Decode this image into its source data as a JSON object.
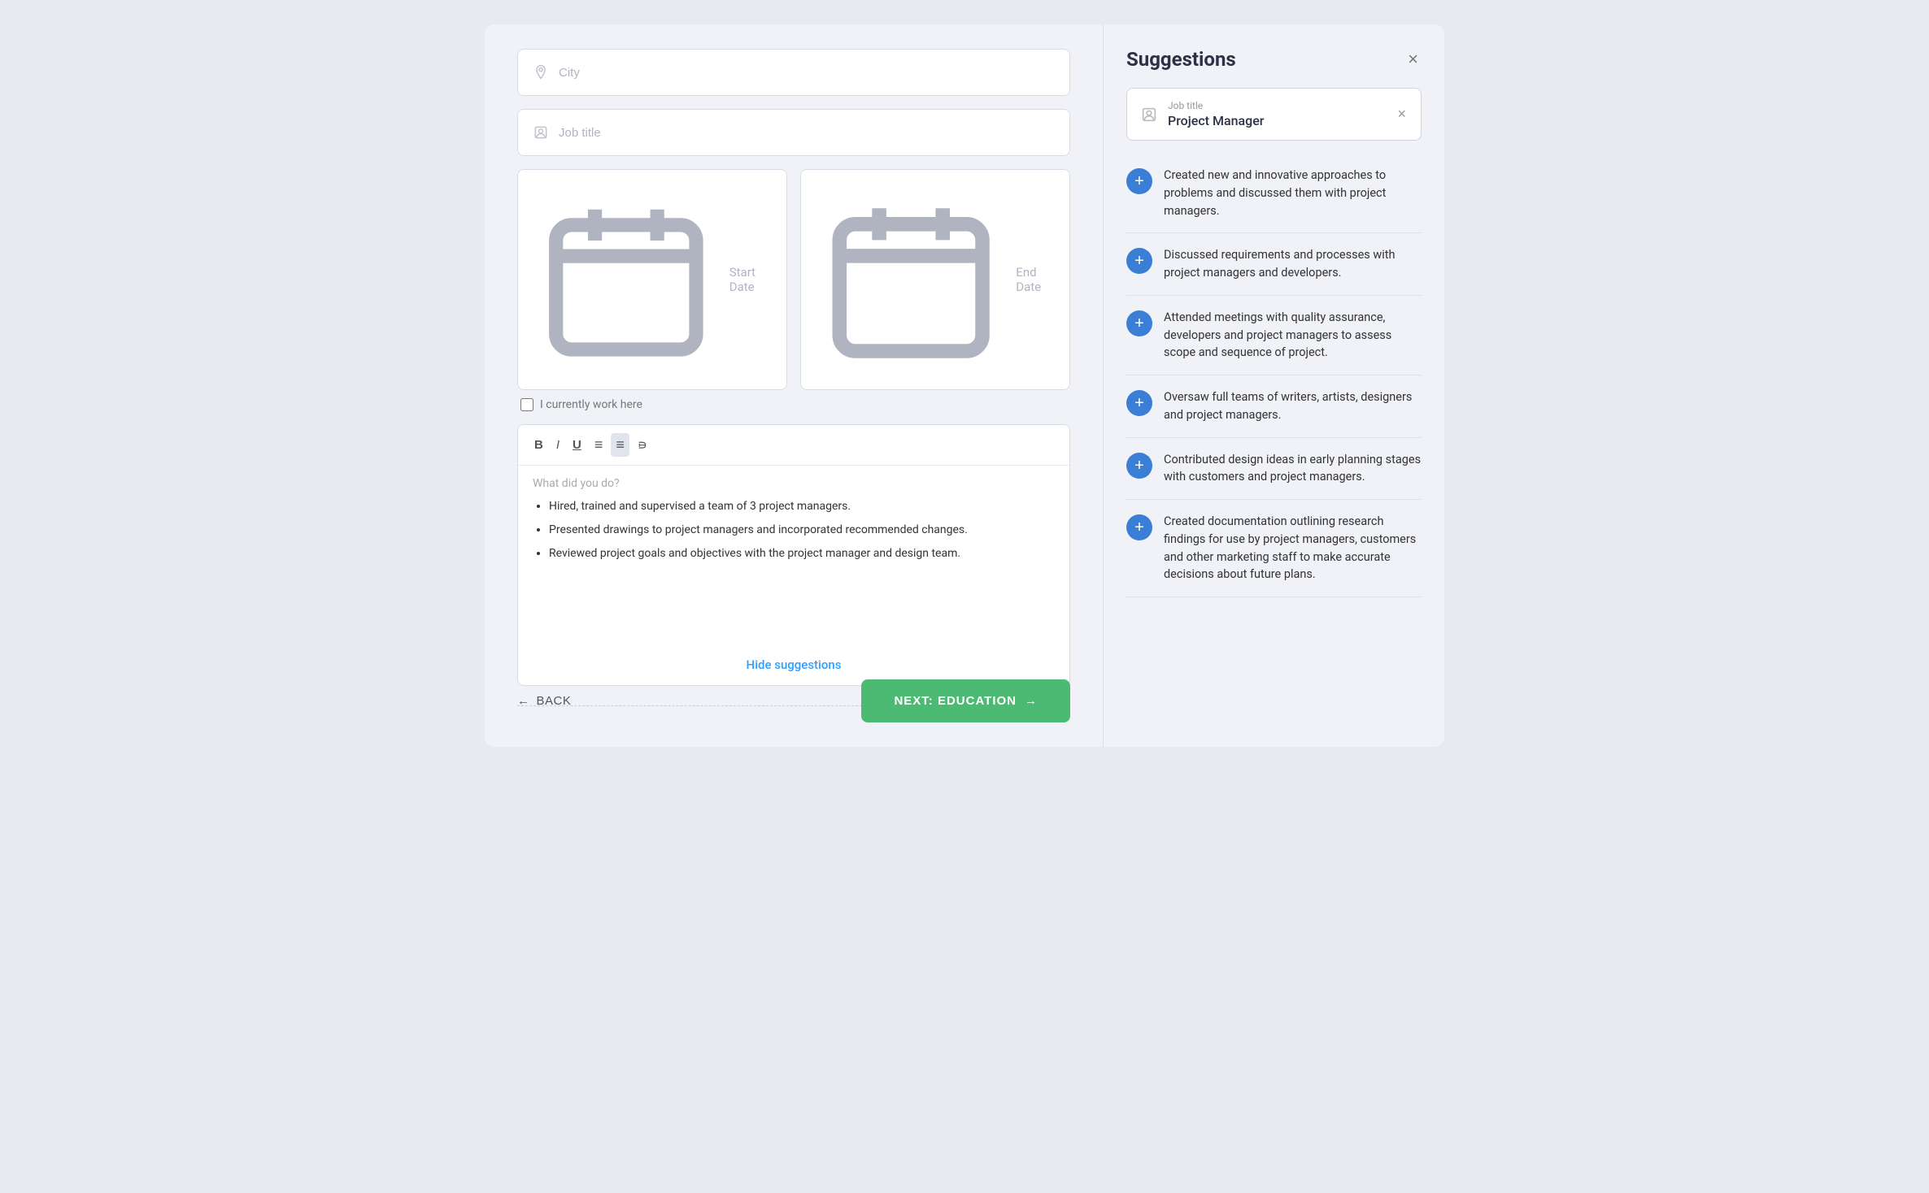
{
  "left": {
    "city_placeholder": "City",
    "job_title_placeholder": "Job title",
    "start_date_placeholder": "Start Date",
    "end_date_placeholder": "End Date",
    "currently_work_label": "I currently work here",
    "editor": {
      "placeholder": "What did you do?",
      "bullets": [
        "Hired, trained and supervised a team of 3 project managers.",
        "Presented drawings to project managers and incorporated recommended changes.",
        "Reviewed project goals and objectives with the project manager and design team."
      ]
    },
    "hide_suggestions_label": "Hide suggestions",
    "back_label": "BACK",
    "next_label": "NEXT: EDUCATION"
  },
  "right": {
    "title": "Suggestions",
    "close_icon": "×",
    "job_field": {
      "label": "Job title",
      "value": "Project Manager"
    },
    "suggestions": [
      "Created new and innovative approaches to problems and discussed them with project managers.",
      "Discussed requirements and processes with project managers and developers.",
      "Attended meetings with quality assurance, developers and project managers to assess scope and sequence of project.",
      "Oversaw full teams of writers, artists, designers and project managers.",
      "Contributed design ideas in early planning stages with customers and project managers.",
      "Created documentation outlining research findings for use by project managers, customers and other marketing staff to make accurate decisions about future plans."
    ]
  },
  "icons": {
    "location": "⚲",
    "person": "👤",
    "calendar": "📅",
    "bold": "B",
    "italic": "I",
    "underline": "U",
    "align": "≡",
    "list": "☰",
    "clear": "⌫",
    "arrow_left": "←",
    "arrow_right": "→",
    "plus": "+"
  }
}
